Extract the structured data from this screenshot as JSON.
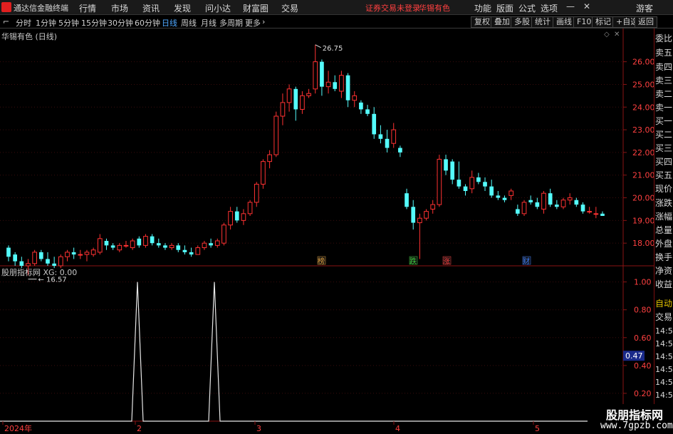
{
  "app": {
    "title": "通达信金融终端",
    "menu": [
      "行情",
      "市场",
      "资讯",
      "发现",
      "问小达",
      "财富圈",
      "交易"
    ],
    "status": "证券交易未登录",
    "stock_name": "华锡有色",
    "right_menu": [
      "功能",
      "版面",
      "公式",
      "选项"
    ],
    "guest": "游客"
  },
  "toolbar": {
    "periods": [
      "分时",
      "1分钟",
      "5分钟",
      "15分钟",
      "30分钟",
      "60分钟",
      "日线",
      "周线",
      "月线",
      "多周期",
      "更多"
    ],
    "active_period": "日线",
    "buttons": [
      "复权",
      "叠加",
      "多股",
      "统计",
      "画线",
      "F10",
      "标记",
      "+自选",
      "返回"
    ]
  },
  "chart": {
    "caption": "华锡有色 (日线)",
    "indicator_caption": "股朋指标网 XG: 0.00",
    "high_label": "26.75",
    "low_label": "16.57",
    "price_ticks": [
      "26.00",
      "25.00",
      "24.00",
      "23.00",
      "22.00",
      "21.00",
      "20.00",
      "19.00",
      "18.00"
    ],
    "indicator_ticks": [
      "1.00",
      "0.80",
      "0.60",
      "0.40",
      "0.20"
    ],
    "indicator_current": "0.47",
    "date_labels": [
      "2024年",
      "2",
      "3",
      "4",
      "5"
    ],
    "event_markers": [
      {
        "label": "榜",
        "color": "#e0a040"
      },
      {
        "label": "跌",
        "color": "#40d040"
      },
      {
        "label": "涨",
        "color": "#ff4040"
      },
      {
        "label": "财",
        "color": "#4080ff"
      }
    ],
    "up_color": "#ff3232",
    "down_color": "#54fcfc"
  },
  "chart_data": {
    "type": "candlestick",
    "ylim": [
      17.0,
      26.9
    ],
    "candles": [
      [
        17.8,
        17.9,
        17.2,
        17.4
      ],
      [
        17.5,
        17.6,
        17.0,
        17.2
      ],
      [
        17.2,
        17.4,
        16.9,
        17.0
      ],
      [
        17.0,
        17.3,
        16.57,
        17.1
      ],
      [
        17.1,
        17.7,
        17.0,
        17.6
      ],
      [
        17.6,
        17.7,
        17.2,
        17.3
      ],
      [
        17.3,
        17.6,
        17.0,
        17.1
      ],
      [
        17.1,
        17.4,
        16.9,
        17.0
      ],
      [
        17.0,
        17.5,
        16.9,
        17.4
      ],
      [
        17.4,
        17.7,
        17.2,
        17.6
      ],
      [
        17.6,
        17.8,
        17.3,
        17.5
      ],
      [
        17.5,
        17.7,
        17.3,
        17.5
      ],
      [
        17.5,
        17.7,
        17.2,
        17.6
      ],
      [
        17.5,
        17.8,
        17.4,
        17.7
      ],
      [
        17.6,
        18.4,
        17.5,
        18.2
      ],
      [
        18.1,
        18.2,
        17.7,
        17.9
      ],
      [
        17.9,
        18.0,
        17.7,
        17.8
      ],
      [
        17.7,
        18.0,
        17.6,
        17.9
      ],
      [
        17.9,
        18.1,
        17.8,
        17.9
      ],
      [
        17.8,
        18.2,
        17.7,
        18.1
      ],
      [
        18.2,
        18.3,
        17.8,
        17.9
      ],
      [
        17.9,
        18.4,
        17.8,
        18.3
      ],
      [
        18.3,
        18.4,
        17.9,
        18.0
      ],
      [
        18.0,
        18.2,
        17.8,
        17.9
      ],
      [
        17.9,
        18.0,
        17.7,
        17.8
      ],
      [
        17.8,
        18.0,
        17.7,
        17.9
      ],
      [
        17.9,
        18.0,
        17.6,
        17.7
      ],
      [
        17.7,
        17.9,
        17.5,
        17.6
      ],
      [
        17.6,
        17.8,
        17.4,
        17.5
      ],
      [
        17.5,
        17.9,
        17.5,
        17.8
      ],
      [
        17.8,
        18.1,
        17.7,
        18.0
      ],
      [
        18.0,
        18.2,
        17.8,
        17.9
      ],
      [
        17.9,
        18.2,
        17.8,
        18.1
      ],
      [
        18.0,
        18.9,
        17.9,
        18.8
      ],
      [
        18.8,
        19.6,
        18.6,
        19.4
      ],
      [
        19.4,
        19.6,
        18.9,
        19.0
      ],
      [
        19.0,
        19.5,
        18.8,
        19.3
      ],
      [
        19.3,
        19.9,
        19.2,
        19.8
      ],
      [
        19.8,
        20.7,
        19.6,
        20.6
      ],
      [
        20.6,
        21.7,
        20.4,
        21.6
      ],
      [
        21.6,
        22.1,
        21.3,
        21.9
      ],
      [
        21.9,
        23.8,
        21.8,
        23.6
      ],
      [
        23.6,
        24.6,
        23.2,
        24.2
      ],
      [
        24.2,
        25.0,
        23.8,
        24.8
      ],
      [
        24.8,
        24.9,
        23.4,
        23.9
      ],
      [
        23.9,
        24.7,
        23.7,
        24.5
      ],
      [
        24.5,
        24.8,
        24.4,
        24.6
      ],
      [
        24.8,
        26.75,
        24.6,
        26.0
      ],
      [
        26.0,
        26.1,
        24.5,
        24.9
      ],
      [
        24.9,
        25.6,
        24.6,
        25.1
      ],
      [
        25.1,
        25.4,
        24.7,
        24.8
      ],
      [
        24.7,
        25.6,
        24.4,
        25.4
      ],
      [
        25.4,
        25.5,
        24.0,
        24.3
      ],
      [
        24.3,
        24.7,
        24.0,
        24.5
      ],
      [
        24.2,
        24.3,
        23.7,
        23.9
      ],
      [
        23.9,
        24.1,
        23.6,
        23.7
      ],
      [
        23.7,
        24.0,
        22.6,
        22.8
      ],
      [
        22.8,
        23.2,
        22.4,
        22.6
      ],
      [
        22.6,
        23.0,
        22.0,
        22.2
      ],
      [
        22.4,
        23.3,
        22.2,
        23.0
      ],
      [
        22.2,
        22.3,
        21.8,
        22.0
      ],
      [
        20.2,
        20.4,
        19.5,
        19.6
      ],
      [
        19.6,
        19.9,
        18.6,
        18.9
      ],
      [
        18.9,
        19.3,
        17.3,
        19.1
      ],
      [
        19.1,
        19.5,
        19.0,
        19.4
      ],
      [
        19.5,
        19.9,
        19.3,
        19.7
      ],
      [
        19.7,
        21.9,
        19.6,
        21.7
      ],
      [
        21.7,
        21.9,
        21.0,
        21.2
      ],
      [
        21.6,
        21.7,
        20.6,
        20.8
      ],
      [
        20.8,
        21.6,
        20.4,
        20.5
      ],
      [
        20.5,
        20.6,
        20.1,
        20.3
      ],
      [
        20.4,
        21.2,
        20.2,
        20.9
      ],
      [
        20.9,
        21.1,
        20.6,
        20.7
      ],
      [
        20.7,
        20.9,
        20.3,
        20.5
      ],
      [
        20.5,
        20.8,
        20.0,
        20.1
      ],
      [
        20.1,
        20.3,
        19.9,
        20.0
      ],
      [
        20.0,
        20.1,
        19.8,
        19.9
      ],
      [
        20.1,
        20.4,
        19.9,
        20.3
      ],
      [
        19.5,
        19.7,
        19.2,
        19.3
      ],
      [
        19.3,
        19.9,
        19.2,
        19.8
      ],
      [
        19.9,
        20.1,
        19.7,
        19.8
      ],
      [
        19.8,
        20.0,
        19.5,
        19.6
      ],
      [
        19.5,
        20.3,
        19.3,
        20.2
      ],
      [
        20.2,
        20.4,
        19.6,
        19.7
      ],
      [
        19.7,
        19.9,
        19.5,
        19.6
      ],
      [
        19.6,
        20.0,
        19.5,
        19.9
      ],
      [
        19.9,
        20.2,
        19.7,
        20.0
      ],
      [
        19.9,
        20.0,
        19.6,
        19.7
      ],
      [
        19.7,
        19.8,
        19.3,
        19.4
      ],
      [
        19.4,
        19.6,
        19.3,
        19.4
      ],
      [
        19.3,
        19.6,
        19.1,
        19.3
      ],
      [
        19.3,
        19.4,
        19.2,
        19.2
      ]
    ],
    "indicator": {
      "name": "XG",
      "ylim": [
        0,
        1.08
      ],
      "peaks": [
        23,
        35
      ],
      "count": 102
    }
  }
}
